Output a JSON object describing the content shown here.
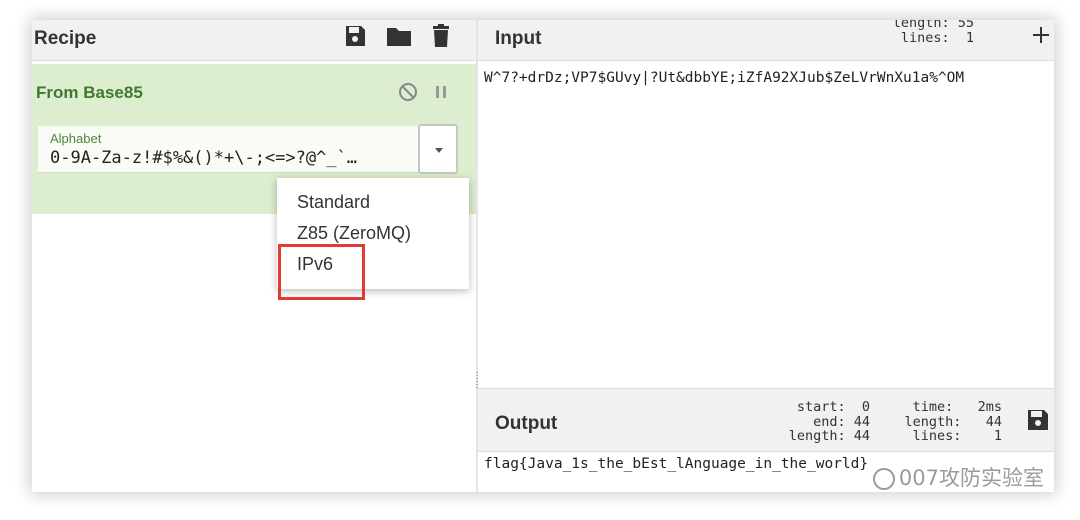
{
  "recipe": {
    "title": "Recipe",
    "icons": [
      "save-icon",
      "folder-icon",
      "trash-icon"
    ]
  },
  "operation": {
    "name": "From Base85",
    "icons": [
      "disable-icon",
      "pause-icon"
    ],
    "alphabet": {
      "label": "Alphabet",
      "value": "0-9A-Za-z!#$%&()*+\\-;<=>?@^_`…"
    }
  },
  "dropdown": {
    "options": [
      "Standard",
      "Z85 (ZeroMQ)",
      "IPv6"
    ],
    "highlighted": "IPv6",
    "highlight_color": "#e03a33"
  },
  "input": {
    "title": "Input",
    "stats": {
      "length_label": "length:",
      "length_value": "55",
      "lines_label": "lines:",
      "lines_value": "1"
    },
    "add_icon": "plus-icon",
    "text": "W^7?+drDz;VP7$GUvy|?Ut&dbbYE;iZfA92XJub$ZeLVrWnXu1a%^OM"
  },
  "output": {
    "title": "Output",
    "stats": {
      "start_label": "start:",
      "start_value": "0",
      "end_label": "end:",
      "end_value": "44",
      "length_label": "length:",
      "length_value": "44",
      "time_label": "time:",
      "time_value": "2ms",
      "length2_label": "length:",
      "length2_value": "44",
      "lines_label": "lines:",
      "lines_value": "1"
    },
    "save_icon": "save-icon",
    "text": "flag{Java_1s_the_bEst_lAnguage_in_the_world}"
  },
  "watermark": {
    "text": "007攻防实验室"
  },
  "colors": {
    "operation_bg": "#dcedd0",
    "operation_title": "#3e7a2e",
    "header_bg": "#f1f1f1"
  }
}
